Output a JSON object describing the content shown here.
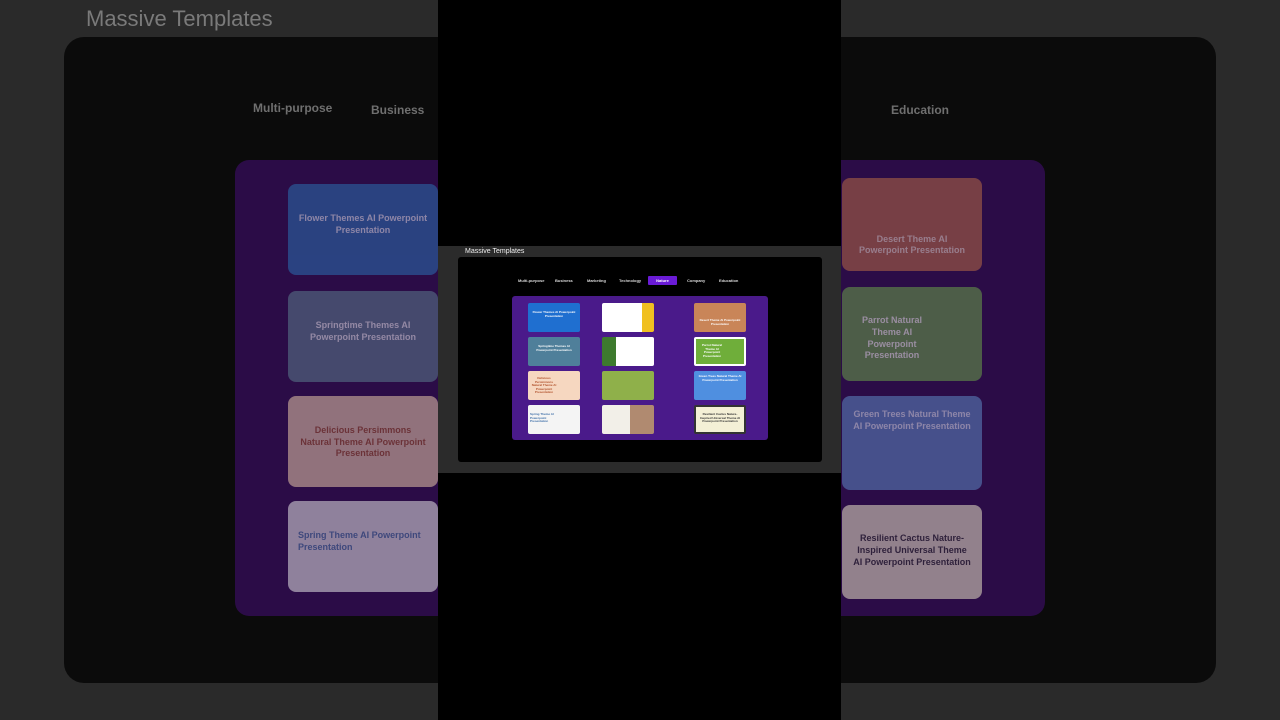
{
  "app_title": "Massive Templates",
  "tabs": [
    {
      "label": "Multi-purpose"
    },
    {
      "label": "Business"
    },
    {
      "label": "Marketing"
    },
    {
      "label": "Technology"
    },
    {
      "label": "Nature"
    },
    {
      "label": "Company"
    },
    {
      "label": "Education"
    }
  ],
  "active_tab": "Nature",
  "cards": [
    {
      "title": "Flower Themes AI Powerpoint Presentation"
    },
    {
      "title": "Springtime Themes AI Powerpoint Presentation"
    },
    {
      "title": "Delicious Persimmons Natural Theme AI Powerpoint Presentation"
    },
    {
      "title": "Spring Theme AI Powerpoint Presentation"
    },
    {
      "title": "Desert Theme AI Powerpoint Presentation"
    },
    {
      "title": "Parrot Natural Theme AI Powerpoint Presentation"
    },
    {
      "title": "Green Trees Natural Theme AI Powerpoint Presentation"
    },
    {
      "title": "Resilient Cactus Nature-Inspired Universal Theme AI Powerpoint Presentation"
    }
  ],
  "colors": {
    "accent": "#6a1bd6",
    "grid_bg": "#4a1a8a"
  }
}
